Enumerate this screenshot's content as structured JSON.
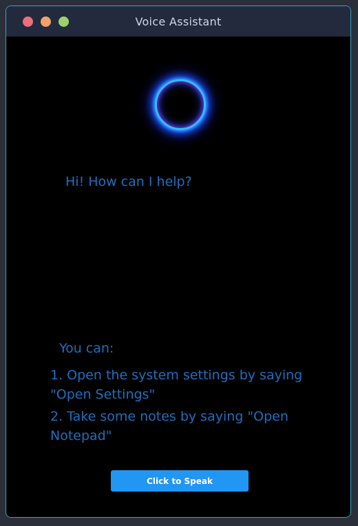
{
  "window": {
    "title": "Voice Assistant"
  },
  "colors": {
    "accent": "#2196f3",
    "text": "#1f6fbf",
    "orb_ring": "#3fb6ff",
    "background": "#000000",
    "titlebar": "#232a3d",
    "close": "#f06d7b",
    "minimize": "#f3a06b",
    "maximize": "#9cd06a"
  },
  "assistant": {
    "greeting": "Hi! How can I help?",
    "hint_heading": "You can:",
    "hints": [
      "1. Open the system settings by saying \"Open Settings\"",
      "2. Take some notes by saying \"Open Notepad\""
    ]
  },
  "actions": {
    "speak_label": "Click to Speak"
  }
}
